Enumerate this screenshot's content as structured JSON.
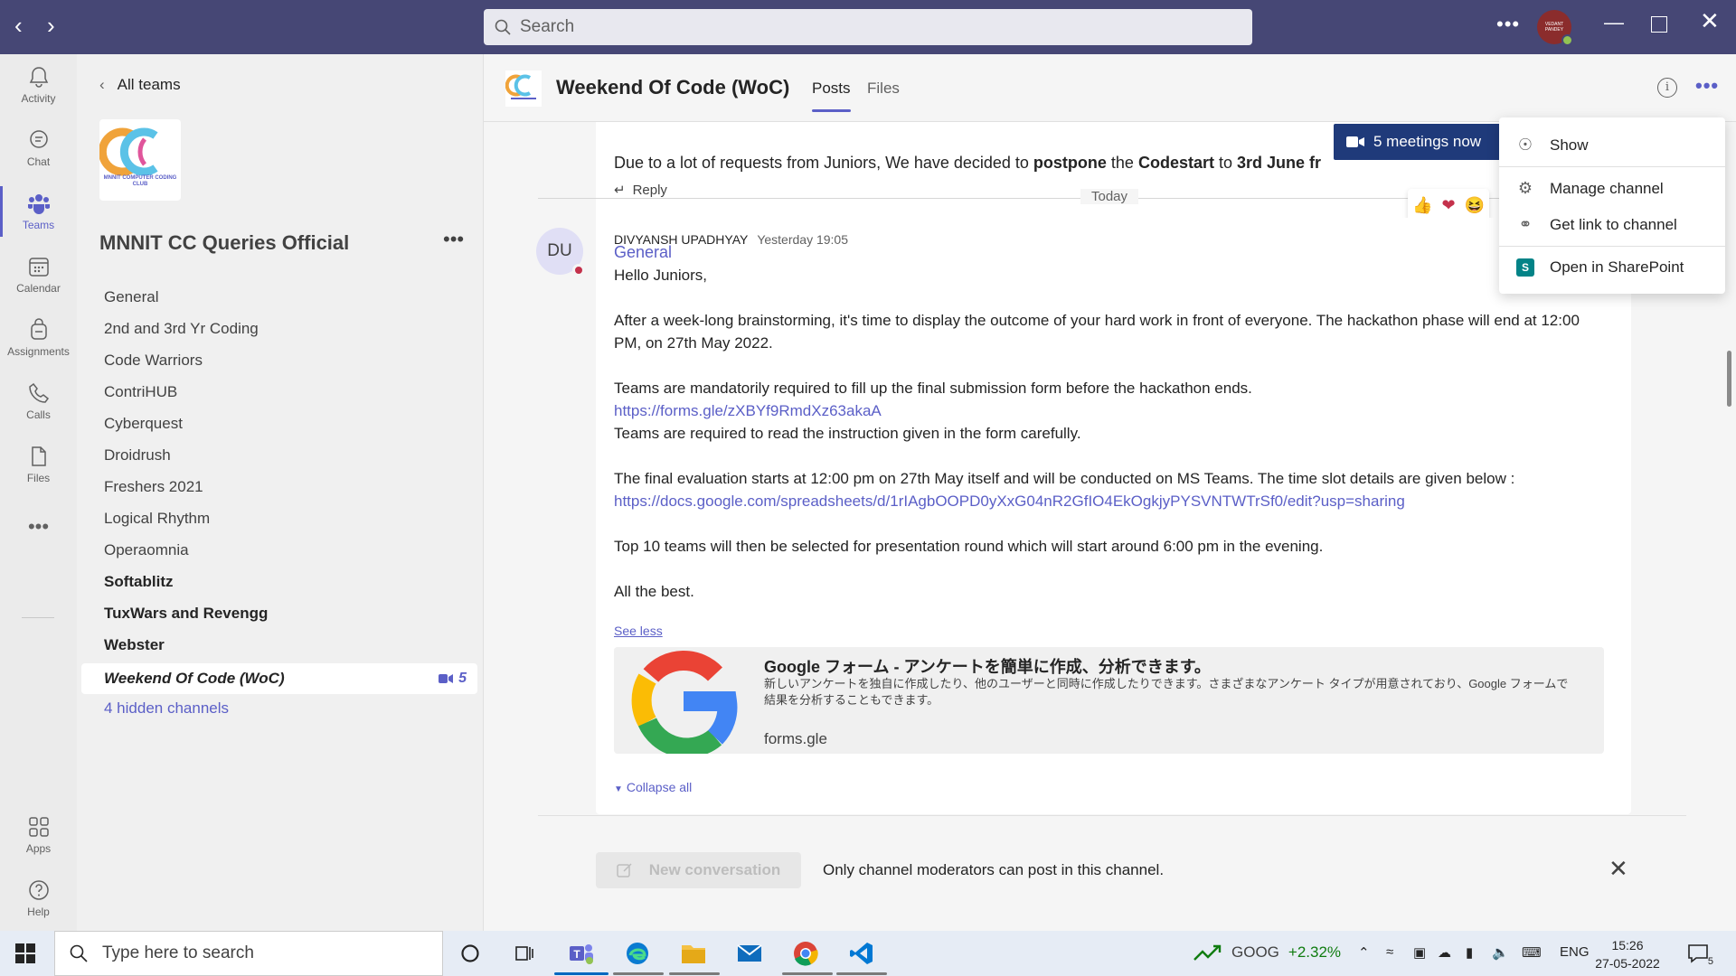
{
  "search": {
    "placeholder": "Search"
  },
  "user": {
    "avatar_text": "VEDANT PANDEY"
  },
  "rail": [
    {
      "label": "Activity"
    },
    {
      "label": "Chat"
    },
    {
      "label": "Teams"
    },
    {
      "label": "Calendar"
    },
    {
      "label": "Assignments"
    },
    {
      "label": "Calls"
    },
    {
      "label": "Files"
    },
    {
      "label": "Apps"
    },
    {
      "label": "Help"
    }
  ],
  "leftpanel": {
    "back_label": "All teams",
    "team_name": "MNNIT CC Queries Official",
    "logo_text": "MNNIT COMPUTER CODING CLUB",
    "channels": [
      "General",
      "2nd and 3rd Yr Coding",
      "Code Warriors",
      "ContriHUB",
      "Cyberquest",
      "Droidrush",
      "Freshers 2021",
      "Logical Rhythm",
      "Operaomnia",
      "Softablitz",
      "TuxWars and Revengg",
      "Webster",
      "Weekend Of Code (WoC)",
      "4 hidden channels"
    ],
    "active_badge": "5"
  },
  "header": {
    "title": "Weekend Of Code (WoC)",
    "tabs": [
      "Posts",
      "Files"
    ]
  },
  "prev_post": {
    "text_a": "Due to a lot of requests from Juniors, We have decided to ",
    "text_b": "postpone",
    "text_c": " the ",
    "text_d": "Codestart",
    "text_e": " to ",
    "text_f": "3rd June fr",
    "reply": "Reply"
  },
  "meeting_banner": "5 meetings now",
  "divider": "Today",
  "post": {
    "avatar": "DU",
    "author": "DIVYANSH UPADHYAY",
    "time": "Yesterday 19:05",
    "subject": "General",
    "lines": [
      "Hello Juniors,",
      "After a week-long brainstorming, it's time to display the outcome of your hard work in front of everyone. The hackathon phase will end at 12:00 PM, on 27th May 2022.",
      "Teams are mandatorily required to fill up the final submission form before the hackathon ends.",
      "https://forms.gle/zXBYf9RmdXz63akaA",
      "Teams are required to read the instruction given in the form carefully.",
      "The final evaluation starts at 12:00 pm on 27th May itself and will be conducted on MS Teams. The time slot details are given below :",
      "https://docs.google.com/spreadsheets/d/1rIAgbOOPD0yXxG04nR2GfIO4EkOgkjyPYSVNTWTrSf0/edit?usp=sharing",
      "Top 10 teams will then be selected for presentation round which will start around 6:00 pm in the evening.",
      "All the best."
    ],
    "see_less": "See less",
    "preview": {
      "title": "Google フォーム - アンケートを簡単に作成、分析できます。",
      "desc": "新しいアンケートを独自に作成したり、他のユーザーと同時に作成したりできます。さまざまなアンケート タイプが用意されており、Google フォームで結果を分析することもできます。",
      "host": "forms.gle"
    },
    "collapse": "Collapse all"
  },
  "compose": {
    "new_conversation": "New conversation",
    "notice": "Only channel moderators can post in this channel."
  },
  "menu": {
    "items": [
      "Show",
      "Manage channel",
      "Get link to channel",
      "Open in SharePoint"
    ]
  },
  "taskbar": {
    "search_placeholder": "Type here to search",
    "stock_symbol": "GOOG",
    "stock_change": "+2.32%",
    "lang": "ENG",
    "time": "15:26",
    "date": "27-05-2022",
    "notif_count": "5"
  },
  "colors": {
    "brand": "#464775",
    "accent": "#5b5fc7",
    "banner": "#1f3a7a"
  }
}
